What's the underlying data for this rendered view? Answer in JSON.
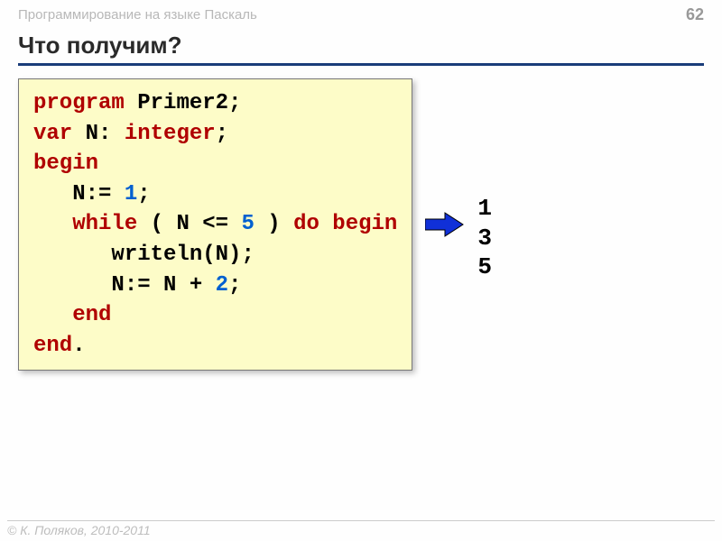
{
  "header": {
    "course": "Программирование на языке Паскаль",
    "page": "62"
  },
  "title": "Что получим?",
  "code": {
    "l1_program": "program",
    "l1_name": " Primer2;",
    "l2_var": "var",
    "l2_decl": " N: ",
    "l2_type": "integer",
    "l2_semi": ";",
    "l3_begin": "begin",
    "l4_indent": "   N:= ",
    "l4_num": "1",
    "l4_semi": ";",
    "l5_indent": "   ",
    "l5_while": "while",
    "l5_cond1": " ( N <= ",
    "l5_num": "5",
    "l5_cond2": " ) ",
    "l5_do": "do",
    "l5_sp": " ",
    "l5_begin": "begin",
    "l6": "      writeln(N);",
    "l7_indent": "      N:= N + ",
    "l7_num": "2",
    "l7_semi": ";",
    "l8_indent": "   ",
    "l8_end": "end",
    "l9_end": "end",
    "l9_dot": "."
  },
  "output": {
    "line1": "1",
    "line2": "3",
    "line3": "5"
  },
  "footer": "© К. Поляков, 2010-2011"
}
